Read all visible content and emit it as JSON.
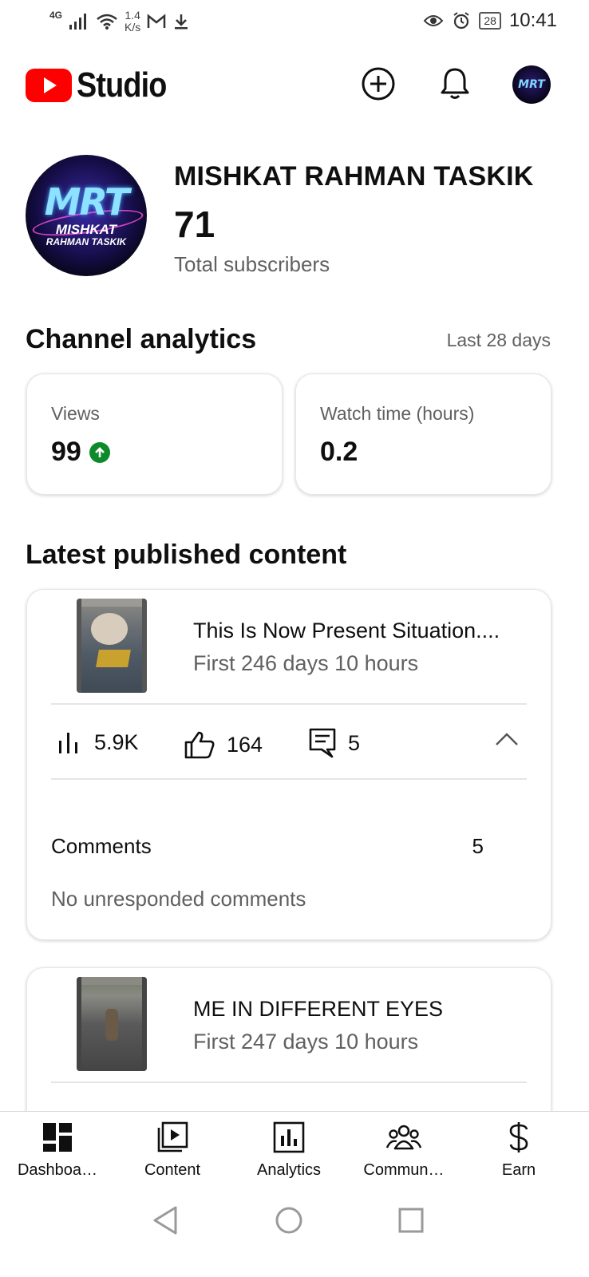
{
  "status_bar": {
    "network": "4G",
    "net_speed_value": "1.4",
    "net_speed_unit": "K/s",
    "battery": "28",
    "time": "10:41"
  },
  "app_bar": {
    "logo_text": "Studio",
    "brand_color": "#ff0000"
  },
  "channel": {
    "name": "MISHKAT RAHMAN TASKIK",
    "subscribers": "71",
    "subscribers_label": "Total subscribers",
    "avatar_text": "MRT"
  },
  "analytics": {
    "title": "Channel analytics",
    "period": "Last 28 days",
    "metrics": [
      {
        "label": "Views",
        "value": "99",
        "trend": "up",
        "trend_color": "#0f8a2a"
      },
      {
        "label": "Watch time (hours)",
        "value": "0.2"
      }
    ]
  },
  "latest": {
    "title": "Latest published content",
    "items": [
      {
        "title": "This Is Now Present Situation....",
        "subtitle": "First 246 days 10 hours",
        "views": "5.9K",
        "likes": "164",
        "comments": "5",
        "comments_label": "Comments",
        "comments_value": "5",
        "comments_note": "No unresponded comments",
        "expanded": true
      },
      {
        "title": "ME IN DIFFERENT EYES",
        "subtitle": "First 247 days 10 hours"
      }
    ]
  },
  "bottom_nav": {
    "items": [
      {
        "label": "Dashboa…",
        "icon": "dashboard-icon"
      },
      {
        "label": "Content",
        "icon": "content-icon"
      },
      {
        "label": "Analytics",
        "icon": "analytics-icon"
      },
      {
        "label": "Commun…",
        "icon": "community-icon"
      },
      {
        "label": "Earn",
        "icon": "earn-icon"
      }
    ]
  }
}
